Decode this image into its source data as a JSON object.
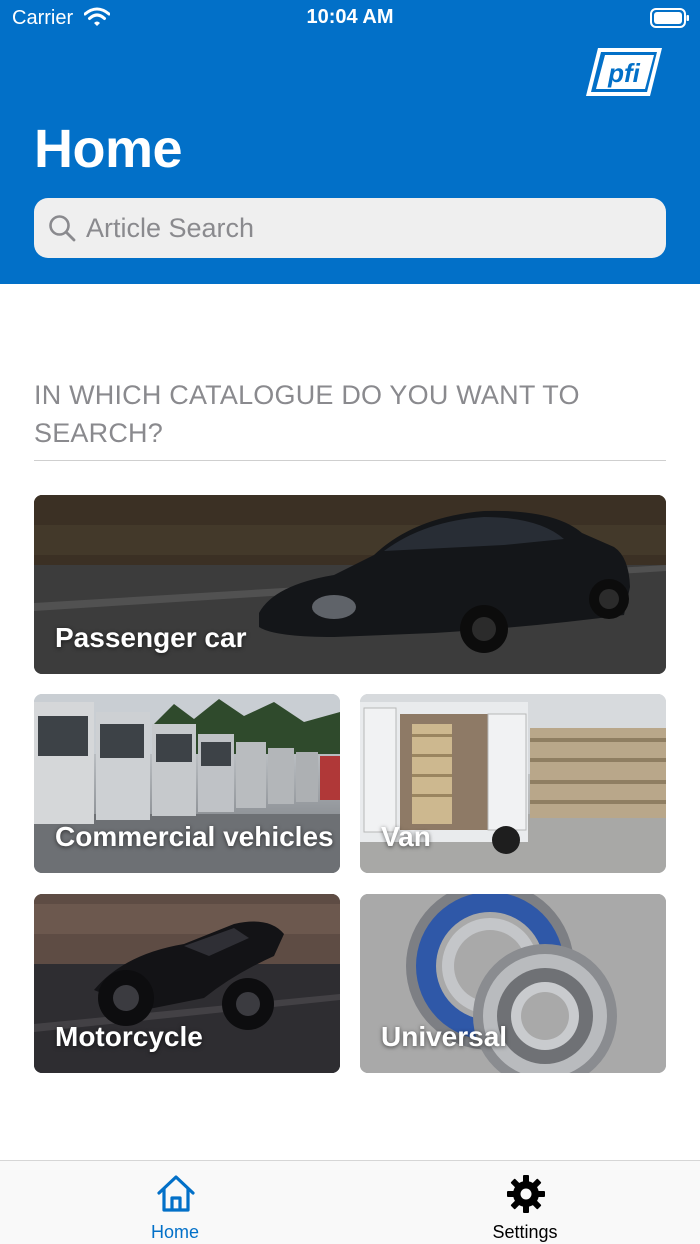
{
  "status_bar": {
    "carrier": "Carrier",
    "time": "10:04 AM",
    "wifi_icon": "wifi-icon",
    "battery_icon": "battery-icon"
  },
  "header": {
    "title": "Home",
    "logo_icon": "pfi-logo",
    "background_color": "#0270c8"
  },
  "search": {
    "placeholder": "Article Search",
    "value": "",
    "icon": "search-icon"
  },
  "catalogue": {
    "heading": "IN WHICH CATALOGUE DO YOU WANT TO SEARCH?",
    "tiles": [
      {
        "label": "Passenger car",
        "image": "sports-car-photo"
      },
      {
        "label": "Commercial vehicles",
        "image": "truck-fleet-photo"
      },
      {
        "label": "Van",
        "image": "van-with-pallets-photo"
      },
      {
        "label": "Motorcycle",
        "image": "motorcycle-photo"
      },
      {
        "label": "Universal",
        "image": "bearings-photo"
      }
    ]
  },
  "tabbar": {
    "tabs": [
      {
        "label": "Home",
        "icon": "home-icon",
        "selected": true
      },
      {
        "label": "Settings",
        "icon": "gear-icon",
        "selected": false
      }
    ],
    "active_color": "#0270c8"
  }
}
